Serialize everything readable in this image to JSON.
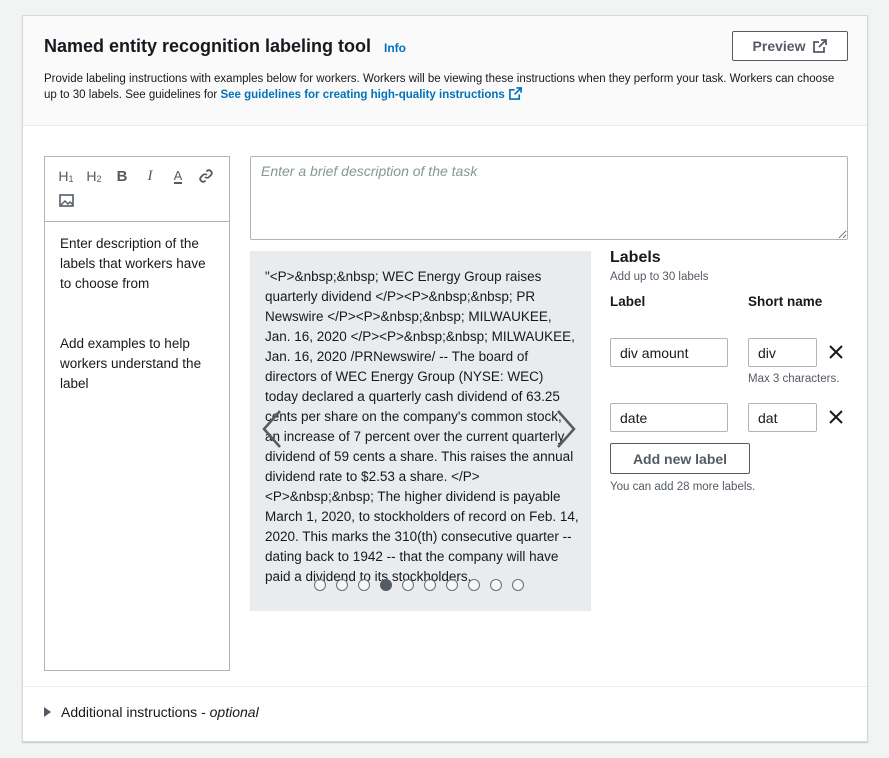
{
  "header": {
    "title": "Named entity recognition labeling tool",
    "info_link": "Info",
    "preview_label": "Preview",
    "description": "Provide labeling instructions with examples below for workers. Workers will be viewing these instructions when they perform your task. Workers can choose up to 30 labels. See guidelines for",
    "guidelines_link": "See guidelines for creating high-quality instructions"
  },
  "editor": {
    "toolbar": [
      "H1",
      "H2",
      "B",
      "I",
      "A"
    ],
    "toolbar_icons": [
      "heading-1-icon",
      "heading-2-icon",
      "bold-icon",
      "italic-icon",
      "text-color-icon",
      "link-icon",
      "image-icon"
    ],
    "paragraph1": "Enter description of the labels that workers have to choose from",
    "paragraph2": "Add examples to help workers understand the label"
  },
  "task_description": {
    "placeholder": "Enter a brief description of the task"
  },
  "carousel": {
    "text": "\"<P>&nbsp;&nbsp; WEC Energy Group raises quarterly dividend </P><P>&nbsp;&nbsp; PR Newswire </P><P>&nbsp;&nbsp; MILWAUKEE, Jan. 16, 2020 </P><P>&nbsp;&nbsp; MILWAUKEE, Jan. 16, 2020 /PRNewswire/ -- The board of directors of WEC Energy Group (NYSE: WEC) today declared a quarterly cash dividend of 63.25 cents per share on the company's common stock, an increase of 7 percent over the current quarterly dividend of 59 cents a share. This raises the annual dividend rate to $2.53 a share. </P><P>&nbsp;&nbsp; The higher dividend is payable March 1, 2020, to stockholders of record on Feb. 14, 2020. This marks the 310(th) consecutive quarter -- dating back to 1942 -- that the company will have paid a dividend to its stockholders.",
    "dot_count": 10,
    "active_dot": 3
  },
  "labels": {
    "title": "Labels",
    "subtitle": "Add up to 30 labels",
    "col_label": "Label",
    "col_short": "Short name",
    "items": [
      {
        "label": "div amount",
        "short": "div"
      },
      {
        "label": "date",
        "short": "dat"
      }
    ],
    "max_hint": "Max 3 characters.",
    "add_button": "Add new label",
    "remaining_hint": "You can add 28 more labels."
  },
  "additional": {
    "label": "Additional instructions - ",
    "optional": "optional"
  }
}
